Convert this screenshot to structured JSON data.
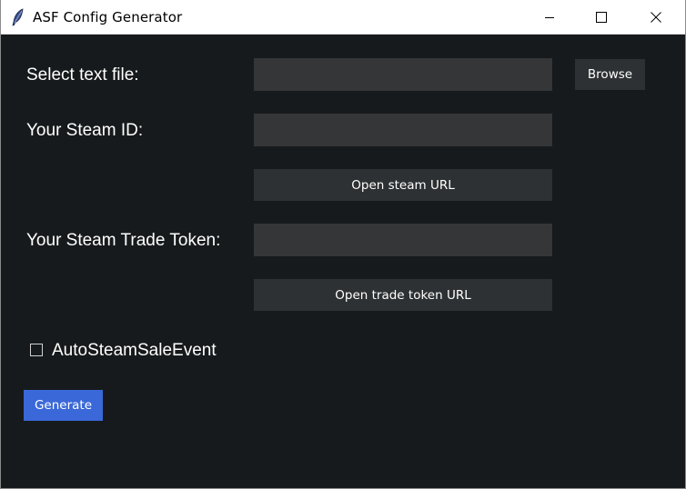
{
  "window": {
    "title": "ASF Config Generator",
    "icons": {
      "app": "feather-icon",
      "minimize": "minimize-icon",
      "maximize": "maximize-icon",
      "close": "close-icon"
    }
  },
  "form": {
    "text_file": {
      "label": "Select text file:",
      "value": "",
      "browse_label": "Browse"
    },
    "steam_id": {
      "label": "Your Steam ID:",
      "value": "",
      "open_url_label": "Open steam URL"
    },
    "trade_token": {
      "label": "Your Steam Trade Token:",
      "value": "",
      "open_url_label": "Open trade token URL"
    },
    "auto_sale": {
      "label": "AutoSteamSaleEvent",
      "checked": false
    },
    "generate_label": "Generate"
  },
  "colors": {
    "background": "#171a1c",
    "entry_bg": "#343638",
    "button_bg": "#2e3133",
    "accent": "#3a68d8"
  }
}
